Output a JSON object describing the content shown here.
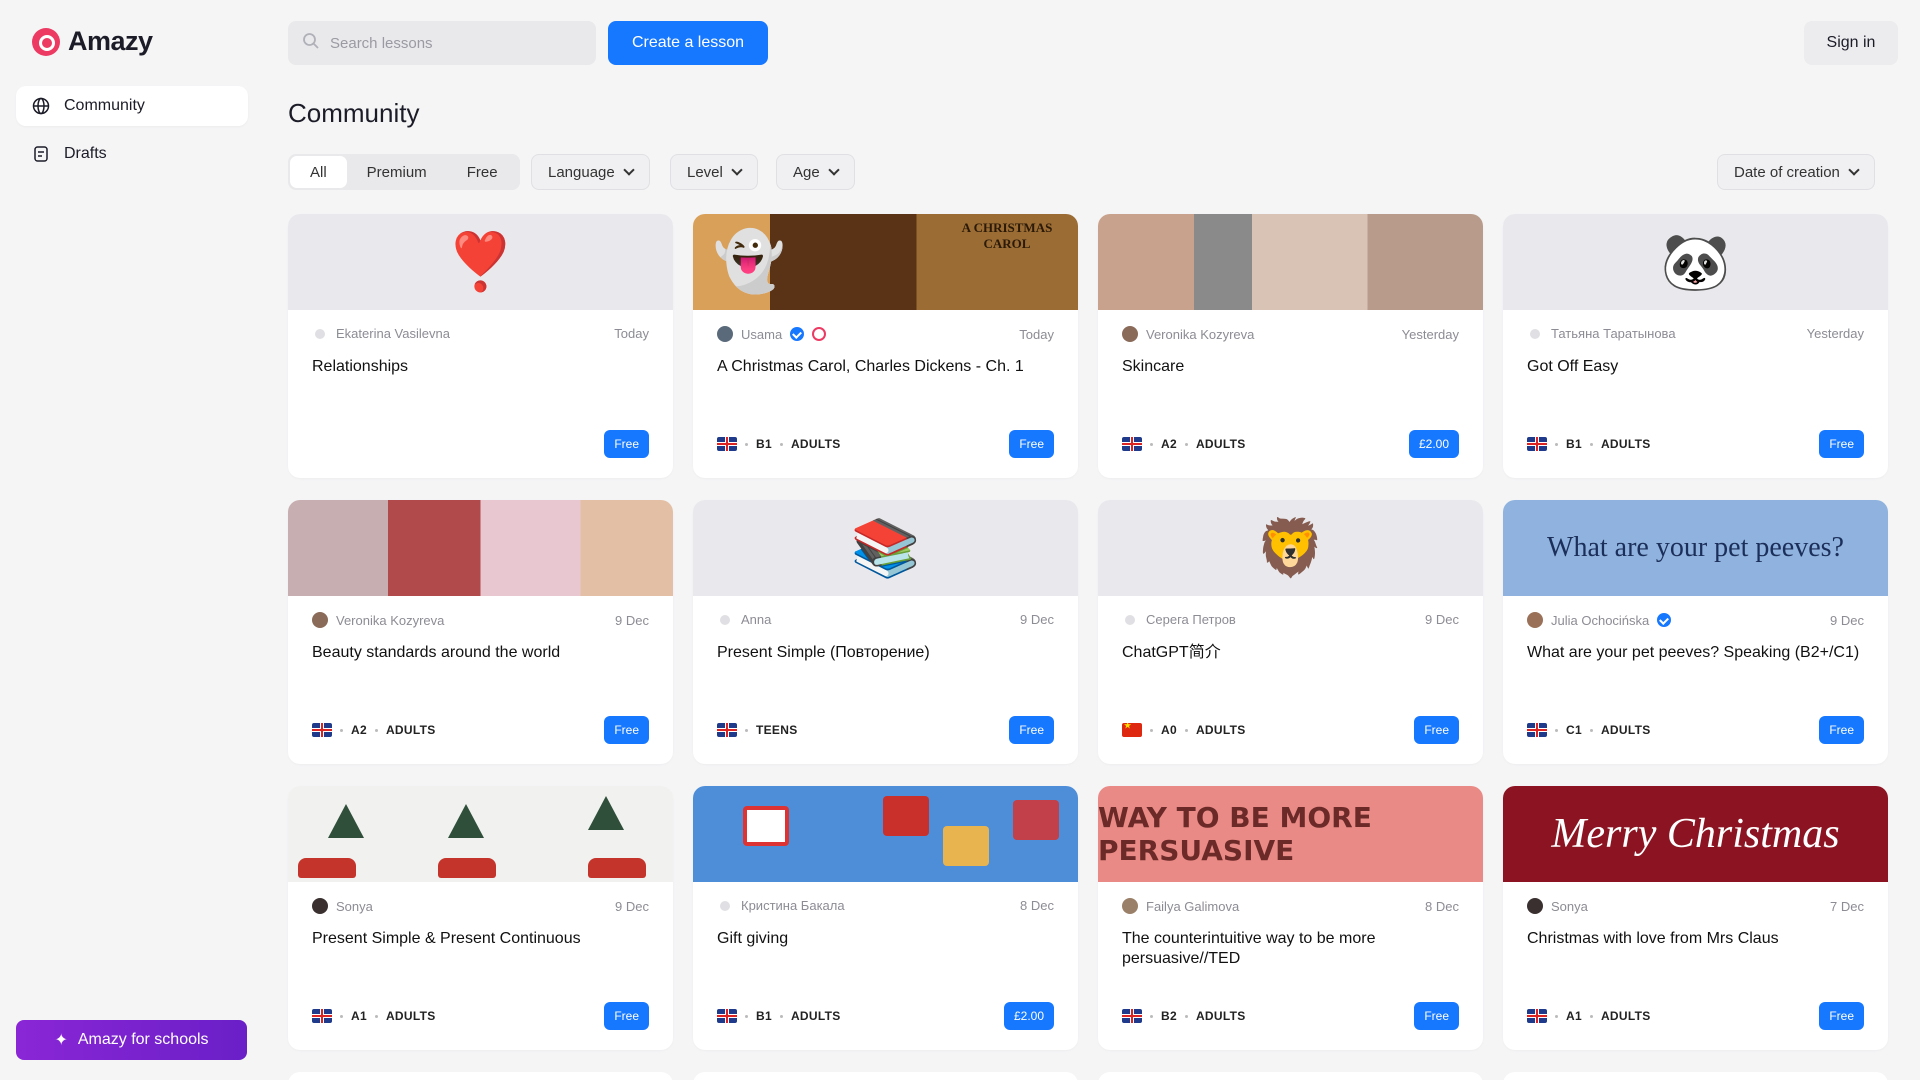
{
  "app": {
    "name": "Amazy"
  },
  "sidebar": {
    "items": [
      {
        "label": "Community",
        "icon": "globe-icon",
        "active": true
      },
      {
        "label": "Drafts",
        "icon": "document-icon",
        "active": false
      }
    ],
    "schools_button": "Amazy for schools"
  },
  "topbar": {
    "search_placeholder": "Search lessons",
    "create_button": "Create a lesson",
    "signin_button": "Sign in"
  },
  "page": {
    "title": "Community"
  },
  "filters": {
    "segments": [
      {
        "label": "All",
        "active": true
      },
      {
        "label": "Premium",
        "active": false
      },
      {
        "label": "Free",
        "active": false
      }
    ],
    "language": "Language",
    "level": "Level",
    "age": "Age",
    "sort": "Date of creation"
  },
  "colors": {
    "accent": "#1677ff",
    "brand": "#ec3a63",
    "schools": "#7a22cf"
  },
  "cards": [
    {
      "author": "Ekaterina Vasilevna",
      "date": "Today",
      "title": "Relationships",
      "level": "",
      "age": "",
      "flag": "",
      "price": "Free",
      "thumb": "❣️"
    },
    {
      "author": "Usama",
      "date": "Today",
      "title": "A Christmas Carol, Charles Dickens - Ch. 1",
      "level": "B1",
      "age": "ADULTS",
      "flag": "uk",
      "price": "Free",
      "thumb": "A CHRISTMAS CAROL"
    },
    {
      "author": "Veronika Kozyreva",
      "date": "Yesterday",
      "title": "Skincare",
      "level": "A2",
      "age": "ADULTS",
      "flag": "uk",
      "price": "£2.00",
      "thumb": ""
    },
    {
      "author": "Татьяна Таратынова",
      "date": "Yesterday",
      "title": "Got Off Easy",
      "level": "B1",
      "age": "ADULTS",
      "flag": "uk",
      "price": "Free",
      "thumb": "🐼"
    },
    {
      "author": "Veronika Kozyreva",
      "date": "9 Dec",
      "title": "Beauty standards around the world",
      "level": "A2",
      "age": "ADULTS",
      "flag": "uk",
      "price": "Free",
      "thumb": ""
    },
    {
      "author": "Anna",
      "date": "9 Dec",
      "title": "Present Simple (Повторение)",
      "level": "",
      "age": "TEENS",
      "flag": "uk",
      "price": "Free",
      "thumb": "📚"
    },
    {
      "author": "Серега Петров",
      "date": "9 Dec",
      "title": "ChatGPT简介",
      "level": "A0",
      "age": "ADULTS",
      "flag": "cn",
      "price": "Free",
      "thumb": "🦁"
    },
    {
      "author": "Julia Ochocińska",
      "date": "9 Dec",
      "title": "What are your pet peeves? Speaking (B2+/C1)",
      "level": "C1",
      "age": "ADULTS",
      "flag": "uk",
      "price": "Free",
      "thumb": "What are your pet peeves?"
    },
    {
      "author": "Sonya",
      "date": "9 Dec",
      "title": "Present Simple & Present Continuous",
      "level": "A1",
      "age": "ADULTS",
      "flag": "uk",
      "price": "Free",
      "thumb": ""
    },
    {
      "author": "Кристина Бакала",
      "date": "8 Dec",
      "title": "Gift giving",
      "level": "B1",
      "age": "ADULTS",
      "flag": "uk",
      "price": "£2.00",
      "thumb": ""
    },
    {
      "author": "Failya Galimova",
      "date": "8 Dec",
      "title": "The counterintuitive way to be more persuasive//TED",
      "level": "B2",
      "age": "ADULTS",
      "flag": "uk",
      "price": "Free",
      "thumb": "WAY TO BE MORE PERSUASIVE"
    },
    {
      "author": "Sonya",
      "date": "7 Dec",
      "title": "Christmas with love from Mrs Claus",
      "level": "A1",
      "age": "ADULTS",
      "flag": "uk",
      "price": "Free",
      "thumb": "Merry Christmas"
    }
  ]
}
